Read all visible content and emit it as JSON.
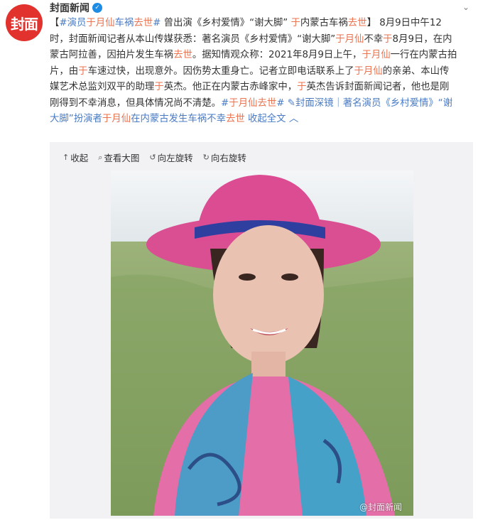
{
  "author": {
    "avatar_text": "封面",
    "name": "封面新闻",
    "verified_icon": "verified-badge-icon"
  },
  "post": {
    "segments": [
      {
        "t": "【",
        "c": ""
      },
      {
        "t": "#演员",
        "c": "lk"
      },
      {
        "t": "于月仙",
        "c": "hl"
      },
      {
        "t": "车祸",
        "c": "lk"
      },
      {
        "t": "去世",
        "c": "hl"
      },
      {
        "t": "#",
        "c": "lk"
      },
      {
        "t": " 曾出演《乡村爱情》“谢大脚” ",
        "c": ""
      },
      {
        "t": "于",
        "c": "hl"
      },
      {
        "t": "内蒙古车祸",
        "c": ""
      },
      {
        "t": "去世",
        "c": "hl"
      },
      {
        "t": "】 8月9日中午12",
        "c": ""
      },
      {
        "t": "\n",
        "c": ""
      },
      {
        "t": "时，封面新闻记者从本山传媒获悉：著名演员《乡村爱情》“谢大脚”",
        "c": ""
      },
      {
        "t": "于月仙",
        "c": "hl"
      },
      {
        "t": "不幸",
        "c": ""
      },
      {
        "t": "于",
        "c": "hl"
      },
      {
        "t": "8月9日，在内",
        "c": ""
      },
      {
        "t": "\n",
        "c": ""
      },
      {
        "t": "蒙古阿拉善，因拍片发生车祸",
        "c": ""
      },
      {
        "t": "去世",
        "c": "hl"
      },
      {
        "t": "。据知情观众称：2021年8月9日上午，",
        "c": ""
      },
      {
        "t": "于月仙",
        "c": "hl"
      },
      {
        "t": "一行在内蒙古拍",
        "c": ""
      },
      {
        "t": "\n",
        "c": ""
      },
      {
        "t": "片，由",
        "c": ""
      },
      {
        "t": "于",
        "c": "hl"
      },
      {
        "t": "车速过快，出现意外。因伤势太重身亡。记者立即电话联系上了",
        "c": ""
      },
      {
        "t": "于月仙",
        "c": "hl"
      },
      {
        "t": "的亲弟、本山传",
        "c": ""
      },
      {
        "t": "\n",
        "c": ""
      },
      {
        "t": "媒艺术总监刘双平的助理",
        "c": ""
      },
      {
        "t": "于",
        "c": "hl"
      },
      {
        "t": "英杰。他正在内蒙古赤峰家中，",
        "c": ""
      },
      {
        "t": "于",
        "c": "hl"
      },
      {
        "t": "英杰告诉封面新闻记者，他也是刚",
        "c": ""
      },
      {
        "t": "\n",
        "c": ""
      },
      {
        "t": "刚得到不幸消息，但具体情况尚不清楚。",
        "c": ""
      },
      {
        "t": "#",
        "c": "lk"
      },
      {
        "t": "于月仙",
        "c": "hl"
      },
      {
        "t": "去世",
        "c": "hl"
      },
      {
        "t": "#",
        "c": "lk"
      },
      {
        "t": " ",
        "c": ""
      },
      {
        "t": "✎封面深镜｜著名演员《乡村爱情》“谢",
        "c": "lk"
      },
      {
        "t": "\n",
        "c": ""
      },
      {
        "t": "大脚”扮演者",
        "c": "lk"
      },
      {
        "t": "于月仙",
        "c": "hl"
      },
      {
        "t": "在内蒙古发生车祸不幸",
        "c": "lk"
      },
      {
        "t": "去世",
        "c": "hl"
      },
      {
        "t": " 收起全文 ︿",
        "c": "lk"
      }
    ]
  },
  "toolbar": {
    "collapse": {
      "icon": "collapse-up-icon",
      "label": "收起"
    },
    "view_large": {
      "icon": "magnifier-icon",
      "label": "查看大图"
    },
    "rotate_left": {
      "icon": "rotate-left-icon",
      "label": "向左旋转"
    },
    "rotate_right": {
      "icon": "rotate-right-icon",
      "label": "向右旋转"
    }
  },
  "photo": {
    "watermark": "@封面新闻"
  },
  "colors": {
    "highlight": "#eb7350",
    "link": "#4a7bc4",
    "panel_bg": "#f2f2f5",
    "avatar_bg": "#e2322d"
  }
}
